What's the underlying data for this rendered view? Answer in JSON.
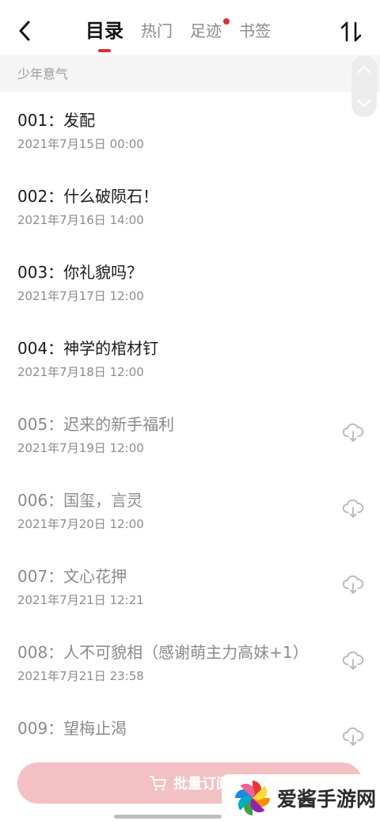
{
  "header": {
    "tabs": [
      {
        "label": "目录",
        "active": true
      },
      {
        "label": "热门",
        "active": false
      },
      {
        "label": "足迹",
        "active": false,
        "has_dot": true
      },
      {
        "label": "书签",
        "active": false
      }
    ],
    "accent_color": "#d9303a"
  },
  "section": {
    "title": "少年意气"
  },
  "chapters": [
    {
      "title": "001：发配",
      "date": "2021年7月15日 00:00",
      "locked": false
    },
    {
      "title": "002：什么破陨石！",
      "date": "2021年7月16日 14:00",
      "locked": false
    },
    {
      "title": "003：你礼貌吗？",
      "date": "2021年7月17日 12:00",
      "locked": false
    },
    {
      "title": "004：神学的棺材钉",
      "date": "2021年7月18日 12:00",
      "locked": false
    },
    {
      "title": "005：迟来的新手福利",
      "date": "2021年7月19日 12:00",
      "locked": true
    },
    {
      "title": "006：国玺，言灵",
      "date": "2021年7月20日 12:00",
      "locked": true
    },
    {
      "title": "007：文心花押",
      "date": "2021年7月21日 12:21",
      "locked": true
    },
    {
      "title": "008：人不可貌相（感谢萌主力高妹+1）",
      "date": "2021年7月21日 23:58",
      "locked": true
    },
    {
      "title": "009：望梅止渴",
      "date": "",
      "locked": true
    }
  ],
  "footer": {
    "subscribe_label": "批量订阅"
  },
  "watermark": {
    "text": "爱酱手游网"
  }
}
